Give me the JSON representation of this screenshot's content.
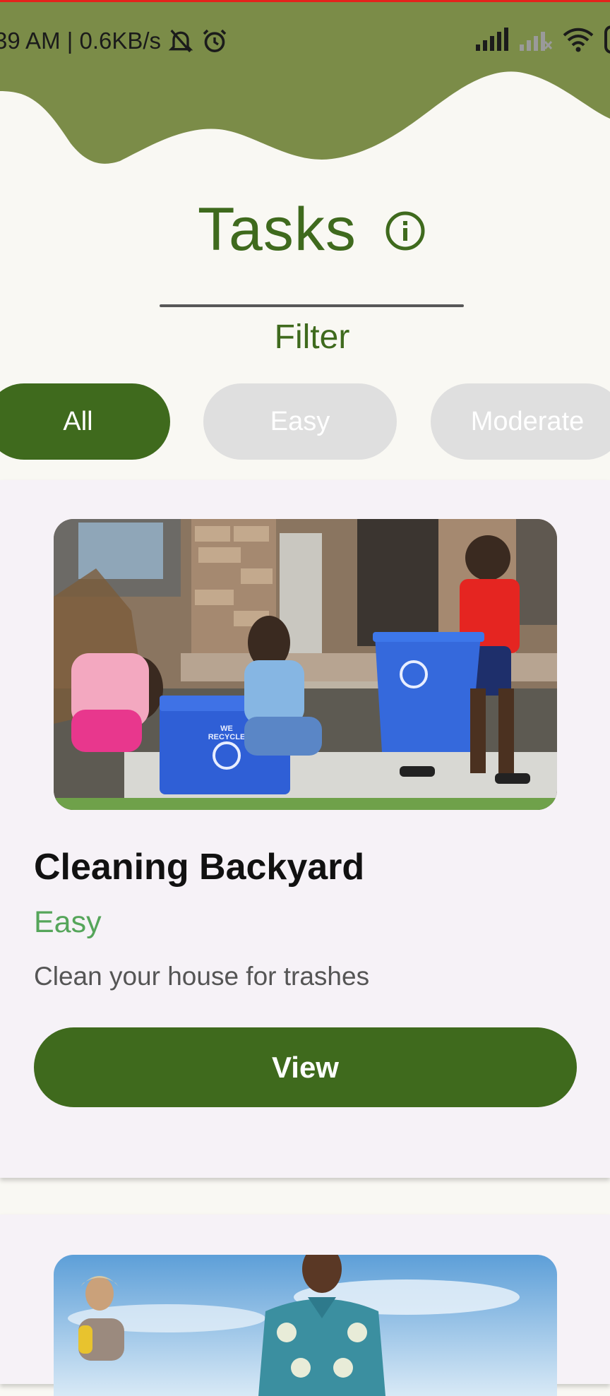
{
  "status_bar": {
    "time_speed": "39 AM | 0.6KB/s",
    "icons": [
      "mute-bell-icon",
      "alarm-icon",
      "signal-icon",
      "signal-no-service-icon",
      "wifi-icon"
    ]
  },
  "header": {
    "title": "Tasks",
    "info_icon": "info-circle-icon"
  },
  "filter": {
    "label": "Filter",
    "options": [
      "All",
      "Easy",
      "Moderate"
    ],
    "selected": "All"
  },
  "tasks": [
    {
      "title": "Cleaning Backyard",
      "level": "Easy",
      "description": "Clean your house for trashes",
      "button": "View",
      "image_text": [
        "WE",
        "RECYCLE"
      ]
    },
    {
      "title": "",
      "level": "",
      "description": "",
      "button": ""
    }
  ],
  "colors": {
    "primary": "#3f6a1d",
    "header_wave": "#7b8c48",
    "background": "#f9f8f3",
    "card_background": "#f6f2f7",
    "easy": "#55a55a",
    "chip_inactive": "#dfdfdf"
  }
}
